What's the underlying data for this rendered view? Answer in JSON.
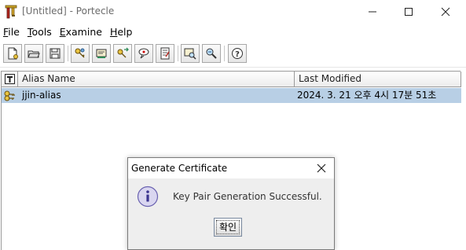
{
  "window": {
    "title": "[Untitled] - Portecle"
  },
  "menu": {
    "items": [
      {
        "prefix": "",
        "mnemonic": "F",
        "rest": "ile"
      },
      {
        "prefix": "",
        "mnemonic": "T",
        "rest": "ools"
      },
      {
        "prefix": "",
        "mnemonic": "E",
        "rest": "xamine"
      },
      {
        "prefix": "",
        "mnemonic": "H",
        "rest": "elp"
      }
    ]
  },
  "toolbar": {
    "buttons": [
      "new-keystore-icon",
      "open-keystore-icon",
      "save-keystore-icon",
      "generate-key-pair-icon",
      "import-trusted-certificate-icon",
      "import-key-pair-icon",
      "set-keystore-password-icon",
      "keystore-report-icon",
      "examine-certificate-icon",
      "examine-ssl-icon",
      "help-icon"
    ]
  },
  "table": {
    "columns": {
      "alias": "Alias Name",
      "modified": "Last Modified"
    },
    "rows": [
      {
        "alias": "jjin-alias",
        "modified": "2024. 3. 21 오후 4시 17분 51초"
      }
    ]
  },
  "dialog": {
    "title": "Generate Certificate",
    "message": "Key Pair Generation Successful.",
    "ok_label": "확인"
  },
  "colors": {
    "selected_row": "#b8cfe5",
    "dialog_body": "#eeeeee"
  }
}
